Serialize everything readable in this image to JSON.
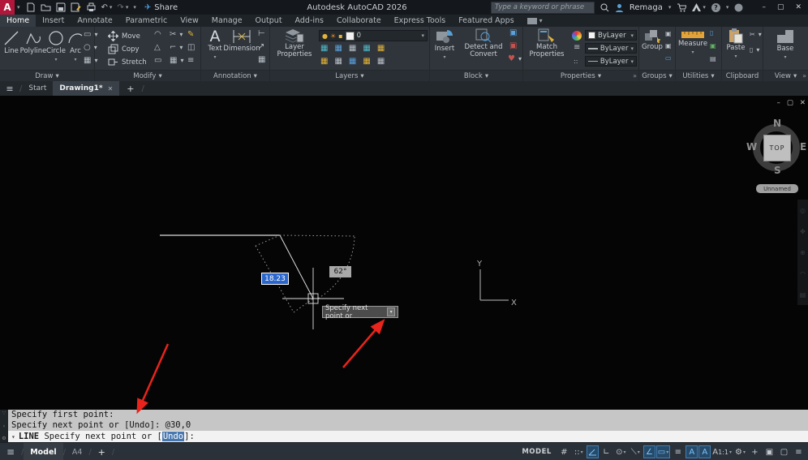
{
  "titlebar": {
    "logo": "A",
    "title": "Autodesk AutoCAD 2026",
    "share": "Share",
    "search_placeholder": "Type a keyword or phrase",
    "user": "Remaga"
  },
  "ribbon_tabs": [
    "Home",
    "Insert",
    "Annotate",
    "Parametric",
    "View",
    "Manage",
    "Output",
    "Add-ins",
    "Collaborate",
    "Express Tools",
    "Featured Apps"
  ],
  "ribbon": {
    "draw": {
      "label": "Draw",
      "buttons": [
        "Line",
        "Polyline",
        "Circle",
        "Arc"
      ]
    },
    "modify": {
      "label": "Modify",
      "buttons": [
        "Move",
        "Copy",
        "Stretch"
      ]
    },
    "annotation": {
      "label": "Annotation",
      "text": "Text",
      "dimension": "Dimension"
    },
    "layers": {
      "label": "Layers",
      "big": "Layer Properties",
      "current_layer": "0"
    },
    "block": {
      "label": "Block",
      "insert": "Insert",
      "detect": "Detect and Convert"
    },
    "properties": {
      "label": "Properties",
      "big": "Match Properties",
      "color": "ByLayer",
      "lineweight": "ByLayer",
      "linetype": "ByLayer"
    },
    "groups": {
      "label": "Groups",
      "big": "Group"
    },
    "utilities": {
      "label": "Utilities",
      "big": "Measure"
    },
    "clipboard": {
      "label": "Clipboard",
      "big": "Paste"
    },
    "view": {
      "label": "View",
      "big": "Base"
    }
  },
  "file_tabs": {
    "start": "Start",
    "active": "Drawing1*"
  },
  "canvas": {
    "viewcube": {
      "n": "N",
      "w": "W",
      "e": "E",
      "s": "S",
      "top": "TOP",
      "pill": "Unnamed"
    },
    "ucs": {
      "x": "X",
      "y": "Y"
    },
    "dynamic_input": {
      "distance": "18.23",
      "angle": "62°"
    },
    "tooltip": "Specify next point or"
  },
  "command_line": {
    "history_1": "Specify first point:",
    "history_2": "Specify next point or [Undo]: @30,0",
    "command": "LINE",
    "prompt_pre": " Specify next point or [",
    "prompt_option": "Undo",
    "prompt_post": "]:"
  },
  "status_bar": {
    "model_tab": "Model",
    "layout_tab": "A4",
    "model_badge": "MODEL",
    "annotation_scale": "1:1"
  },
  "glyphs": {
    "chevron": "▾",
    "close": "✕",
    "minimize": "–",
    "maximize": "▢",
    "plus": "+",
    "hamburger": "≡",
    "slash": "/",
    "undo": "↶",
    "redo": "↷",
    "plane": "✈",
    "overflow": "»",
    "question": "?",
    "grid": "#",
    "snap": "::",
    "ortho": "∟",
    "polar": "⊙",
    "iso": "⟍",
    "otrack": "∠",
    "osnap": "▭",
    "lineweight": "≡",
    "anno": "A",
    "gear": "⚙",
    "isolate": "▣",
    "fullscreen": "▢",
    "bulb": "●",
    "sun": "☀",
    "lock": "▪",
    "wrench": "⚙",
    "back": "‹",
    "dots": "∵",
    "text_a": "A",
    "mini_table": "▦",
    "mini_leader": "↗",
    "mini_dim": "⊢",
    "rotate": "◠",
    "erase": "✎",
    "mirror": "△",
    "fillet": "⌐",
    "array": "▦",
    "scale_i": "▭",
    "offset": "◫",
    "rect_tool": "▭",
    "ellipse_tool": "○",
    "hatch_tool": "▦",
    "star": "✦",
    "heart": "♥",
    "list": "▤",
    "doc": "▯"
  },
  "colors": {
    "accent_blue": "#4a90d9",
    "logo_red": "#b2163a",
    "arrow_red": "#e8241c",
    "dyn_blue": "#2a66cc"
  }
}
